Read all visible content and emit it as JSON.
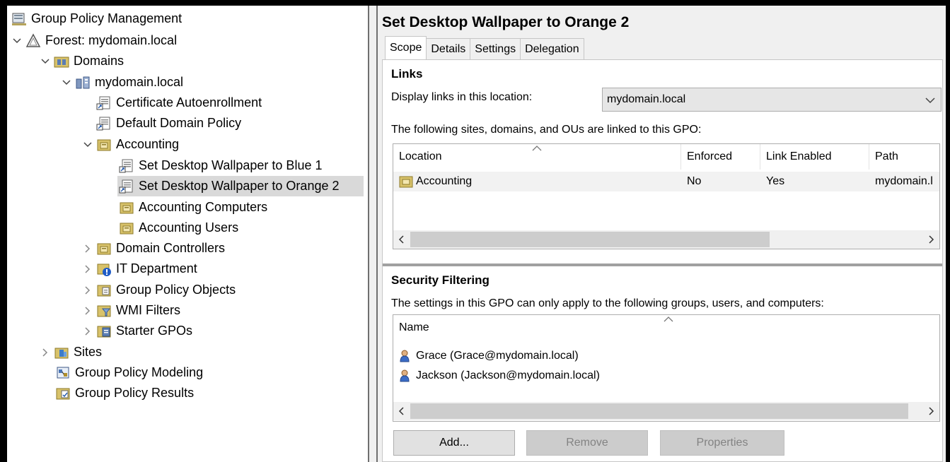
{
  "tree": {
    "root": "Group Policy Management",
    "forest": "Forest: mydomain.local",
    "domains": "Domains",
    "domain": "mydomain.local",
    "cert": "Certificate Autoenrollment",
    "default_policy": "Default Domain Policy",
    "accounting": "Accounting",
    "wall_blue": "Set Desktop Wallpaper to Blue 1",
    "wall_orange": "Set Desktop Wallpaper to Orange 2",
    "acct_computers": "Accounting Computers",
    "acct_users": "Accounting Users",
    "dc": "Domain Controllers",
    "it": "IT Department",
    "gpo": "Group Policy Objects",
    "wmi": "WMI Filters",
    "starter": "Starter GPOs",
    "sites": "Sites",
    "modeling": "Group Policy Modeling",
    "results": "Group Policy Results"
  },
  "gpo_title": "Set Desktop Wallpaper to Orange 2",
  "tabs": [
    "Scope",
    "Details",
    "Settings",
    "Delegation"
  ],
  "links": {
    "heading": "Links",
    "display_label": "Display links in this location:",
    "location_value": "mydomain.local",
    "description": "The following sites, domains, and OUs are linked to this GPO:",
    "columns": [
      "Location",
      "Enforced",
      "Link Enabled",
      "Path"
    ],
    "rows": [
      {
        "location": "Accounting",
        "enforced": "No",
        "link_enabled": "Yes",
        "path": "mydomain.l"
      }
    ]
  },
  "security": {
    "heading": "Security Filtering",
    "description": "The settings in this GPO can only apply to the following groups, users, and computers:",
    "column": "Name",
    "rows": [
      "Grace (Grace@mydomain.local)",
      "Jackson (Jackson@mydomain.local)"
    ]
  },
  "buttons": {
    "add": "Add...",
    "remove": "Remove",
    "properties": "Properties"
  },
  "colors": {
    "selection": "#d9d9d9",
    "panel": "#f0f0f0",
    "folder": "#c9b25a",
    "user_blue": "#3b6cc6"
  }
}
